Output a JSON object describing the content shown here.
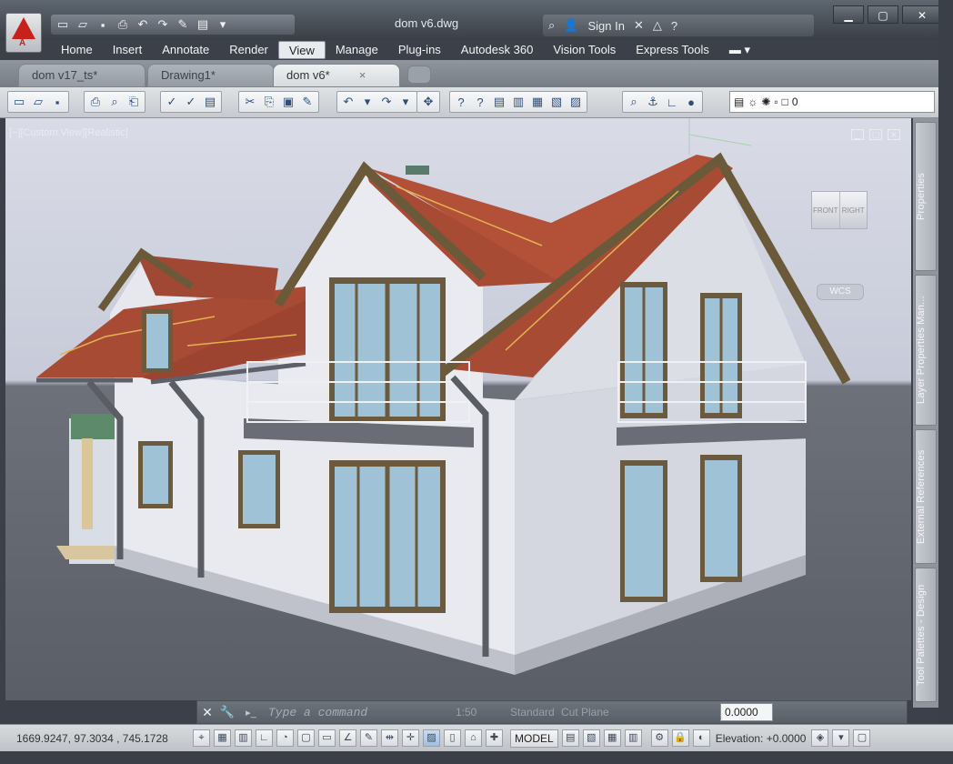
{
  "app": {
    "title": "dom v6.dwg",
    "logo_letter": "A"
  },
  "quick_access": {
    "icons": [
      "new-icon",
      "open-icon",
      "save-icon",
      "print-icon",
      "undo-icon",
      "redo-icon",
      "workspace-icon",
      "properties-icon"
    ]
  },
  "infocenter": {
    "signin_label": "Sign In",
    "help_label": "?"
  },
  "menu": {
    "items": [
      "Home",
      "Insert",
      "Annotate",
      "Render",
      "View",
      "Manage",
      "Plug-ins",
      "Autodesk 360",
      "Vision Tools",
      "Express Tools"
    ],
    "active": "View"
  },
  "tabs": [
    {
      "label": "dom v17_ts*",
      "active": false
    },
    {
      "label": "Drawing1*",
      "active": false
    },
    {
      "label": "dom v6*",
      "active": true,
      "close": "×"
    }
  ],
  "layer": {
    "value": "0"
  },
  "viewport": {
    "label": "[−][Custom View][Realistic]",
    "viewcube": {
      "front": "FRONT",
      "right": "RIGHT"
    },
    "wcs": "WCS"
  },
  "palettes": [
    "Properties",
    "Layer Properties Man...",
    "External References",
    "Tool Palettes - Design"
  ],
  "command_line": {
    "placeholder": "Type a command",
    "scale": "1:50",
    "style": "Standard",
    "cut_plane": "Cut Plane",
    "value": "0.0000"
  },
  "status": {
    "coords": "1669.9247,  97.3034  , 745.1728",
    "model": "MODEL",
    "elevation": "Elevation:  +0.0000"
  },
  "colors": {
    "roof": "#a84b35",
    "roof_edge": "#6b5a3a",
    "wall": "#e6e8ef",
    "window_frame": "#6b5a3e",
    "glass": "#9fc2d6",
    "accent": "#c8201b"
  }
}
